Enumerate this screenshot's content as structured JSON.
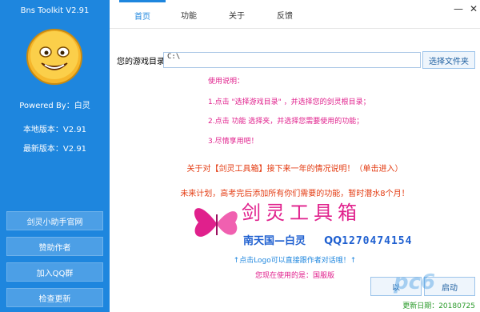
{
  "app": {
    "title": "Bns Toolkit V2.91"
  },
  "sidebar": {
    "powered_by": "Powered By：白灵",
    "local_version": "本地版本：V2.91",
    "latest_version": "最新版本：V2.91",
    "buttons": [
      {
        "label": "剑灵小助手官网"
      },
      {
        "label": "赞助作者"
      },
      {
        "label": "加入QQ群"
      },
      {
        "label": "检查更新"
      }
    ]
  },
  "tabs": [
    {
      "label": "首页",
      "active": true
    },
    {
      "label": "功能",
      "active": false
    },
    {
      "label": "关于",
      "active": false
    },
    {
      "label": "反馈",
      "active": false
    }
  ],
  "window_controls": {
    "minimize": "—",
    "close": "✕"
  },
  "game_dir": {
    "label": "您的游戏目录：",
    "value": "C:\\",
    "browse_button": "选择文件夹"
  },
  "instructions": {
    "heading": "使用说明：",
    "step1": "1.点击 \"选择游戏目录\" ，并选择您的剑灵根目录；",
    "step2": "2.点击 功能 选择夹，并选择您需要使用的功能；",
    "step3": "3.尽情享用吧！"
  },
  "notice_link": "关于对【剑灵工具箱】接下来一年的情况说明！（单击进入）",
  "future_plan": "未来计划，高考完后添加所有你们需要的功能，暂时潜水8个月！",
  "brand": {
    "name": "剑灵工具箱",
    "author": "南天国—白灵",
    "qq_label": "QQ",
    "qq_id": "1270474154"
  },
  "hint": "↑点击Logo可以直接跟作者对话哦！↑",
  "using_version": "您现在使用的是：国服版",
  "bottom_buttons": [
    {
      "label": "以"
    },
    {
      "label": "启动"
    }
  ],
  "update_date": "更新日期：20180725",
  "watermark": "pc6",
  "colors": {
    "sidebar": "#1e86de",
    "accent": "#1e86de",
    "pink": "#e0208c",
    "orange_red": "#e33a10",
    "green": "#2a9a2a"
  }
}
